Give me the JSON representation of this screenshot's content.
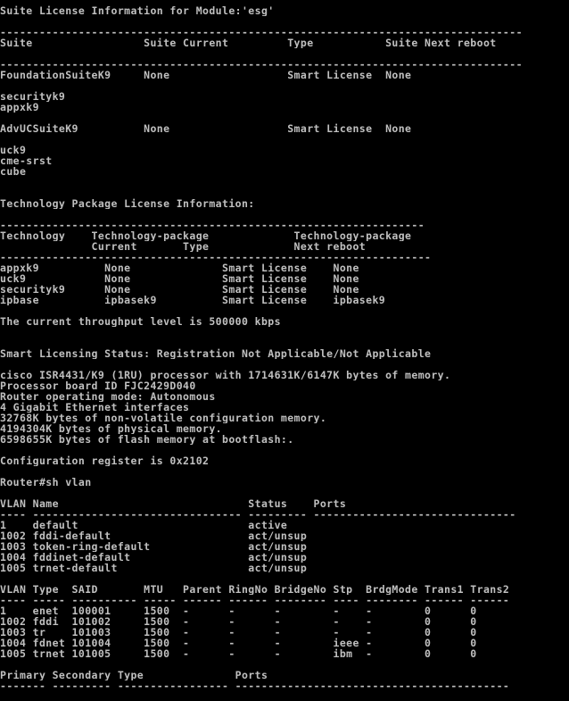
{
  "terminal": {
    "foreground": "#c0c0c0",
    "background": "#000000",
    "lines": [
      "Suite License Information for Module:'esg'",
      "",
      "--------------------------------------------------------------------------------",
      "Suite                 Suite Current         Type           Suite Next reboot",
      "",
      "--------------------------------------------------------------------------------",
      "FoundationSuiteK9     None                  Smart License  None",
      "",
      "securityk9",
      "appxk9",
      "",
      "AdvUCSuiteK9          None                  Smart License  None",
      "",
      "uck9",
      "cme-srst",
      "cube",
      "",
      "",
      "Technology Package License Information:",
      "",
      "-----------------------------------------------------------------",
      "Technology    Technology-package             Technology-package",
      "              Current       Type             Next reboot",
      "------------------------------------------------------------------",
      "appxk9          None              Smart License    None",
      "uck9            None              Smart License    None",
      "securityk9      None              Smart License    None",
      "ipbase          ipbasek9          Smart License    ipbasek9",
      "",
      "The current throughput level is 500000 kbps",
      "",
      "",
      "Smart Licensing Status: Registration Not Applicable/Not Applicable",
      "",
      "cisco ISR4431/K9 (1RU) processor with 1714631K/6147K bytes of memory.",
      "Processor board ID FJC2429D040",
      "Router operating mode: Autonomous",
      "4 Gigabit Ethernet interfaces",
      "32768K bytes of non-volatile configuration memory.",
      "4194304K bytes of physical memory.",
      "6598655K bytes of flash memory at bootflash:.",
      "",
      "Configuration register is 0x2102",
      "",
      "Router#sh vlan",
      "",
      "VLAN Name                             Status    Ports",
      "---- -------------------------------- --------- -------------------------------",
      "1    default                          active",
      "1002 fddi-default                     act/unsup",
      "1003 token-ring-default               act/unsup",
      "1004 fddinet-default                  act/unsup",
      "1005 trnet-default                    act/unsup",
      "",
      "VLAN Type  SAID       MTU   Parent RingNo BridgeNo Stp  BrdgMode Trans1 Trans2",
      "---- ----- ---------- ----- ------ ------ -------- ---- -------- ------ ------",
      "1    enet  100001     1500  -      -      -        -    -        0      0",
      "1002 fddi  101002     1500  -      -      -        -    -        0      0",
      "1003 tr    101003     1500  -      -      -        -    -        0      0",
      "1004 fdnet 101004     1500  -      -      -        ieee -        0      0",
      "1005 trnet 101005     1500  -      -      -        ibm  -        0      0",
      "",
      "Primary Secondary Type              Ports",
      "------- --------- ----------------- ------------------------------------------"
    ]
  }
}
